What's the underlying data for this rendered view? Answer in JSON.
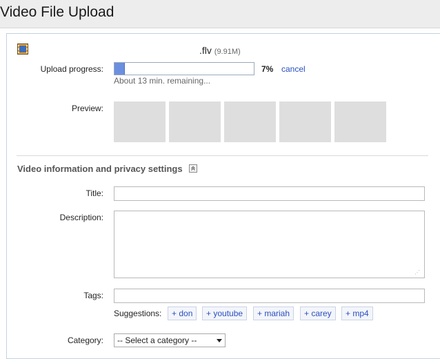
{
  "header": {
    "title": "Video File Upload"
  },
  "file": {
    "name": ".flv",
    "size": "(9.91M)",
    "icon": "film-icon"
  },
  "upload": {
    "label": "Upload progress:",
    "progress": 0.07,
    "percent_text": "7%",
    "cancel_label": "cancel",
    "remaining_text": "About 13 min. remaining..."
  },
  "preview": {
    "label": "Preview:",
    "thumbnail_count": 5
  },
  "section": {
    "title": "Video information and privacy settings",
    "toggle_icon": "collapse-up-icon"
  },
  "form": {
    "title_label": "Title:",
    "title_value": "",
    "description_label": "Description:",
    "description_value": "",
    "tags_label": "Tags:",
    "tags_value": "",
    "suggestions_label": "Suggestions:",
    "suggestions": [
      "+ don",
      "+ youtube",
      "+ mariah",
      "+ carey",
      "+ mp4"
    ],
    "category_label": "Category:",
    "category_selected": "-- Select a category --"
  },
  "colors": {
    "progress_fill": "#6b8fe0",
    "link": "#2a4fbf",
    "panel_border": "#c3d2e2"
  }
}
